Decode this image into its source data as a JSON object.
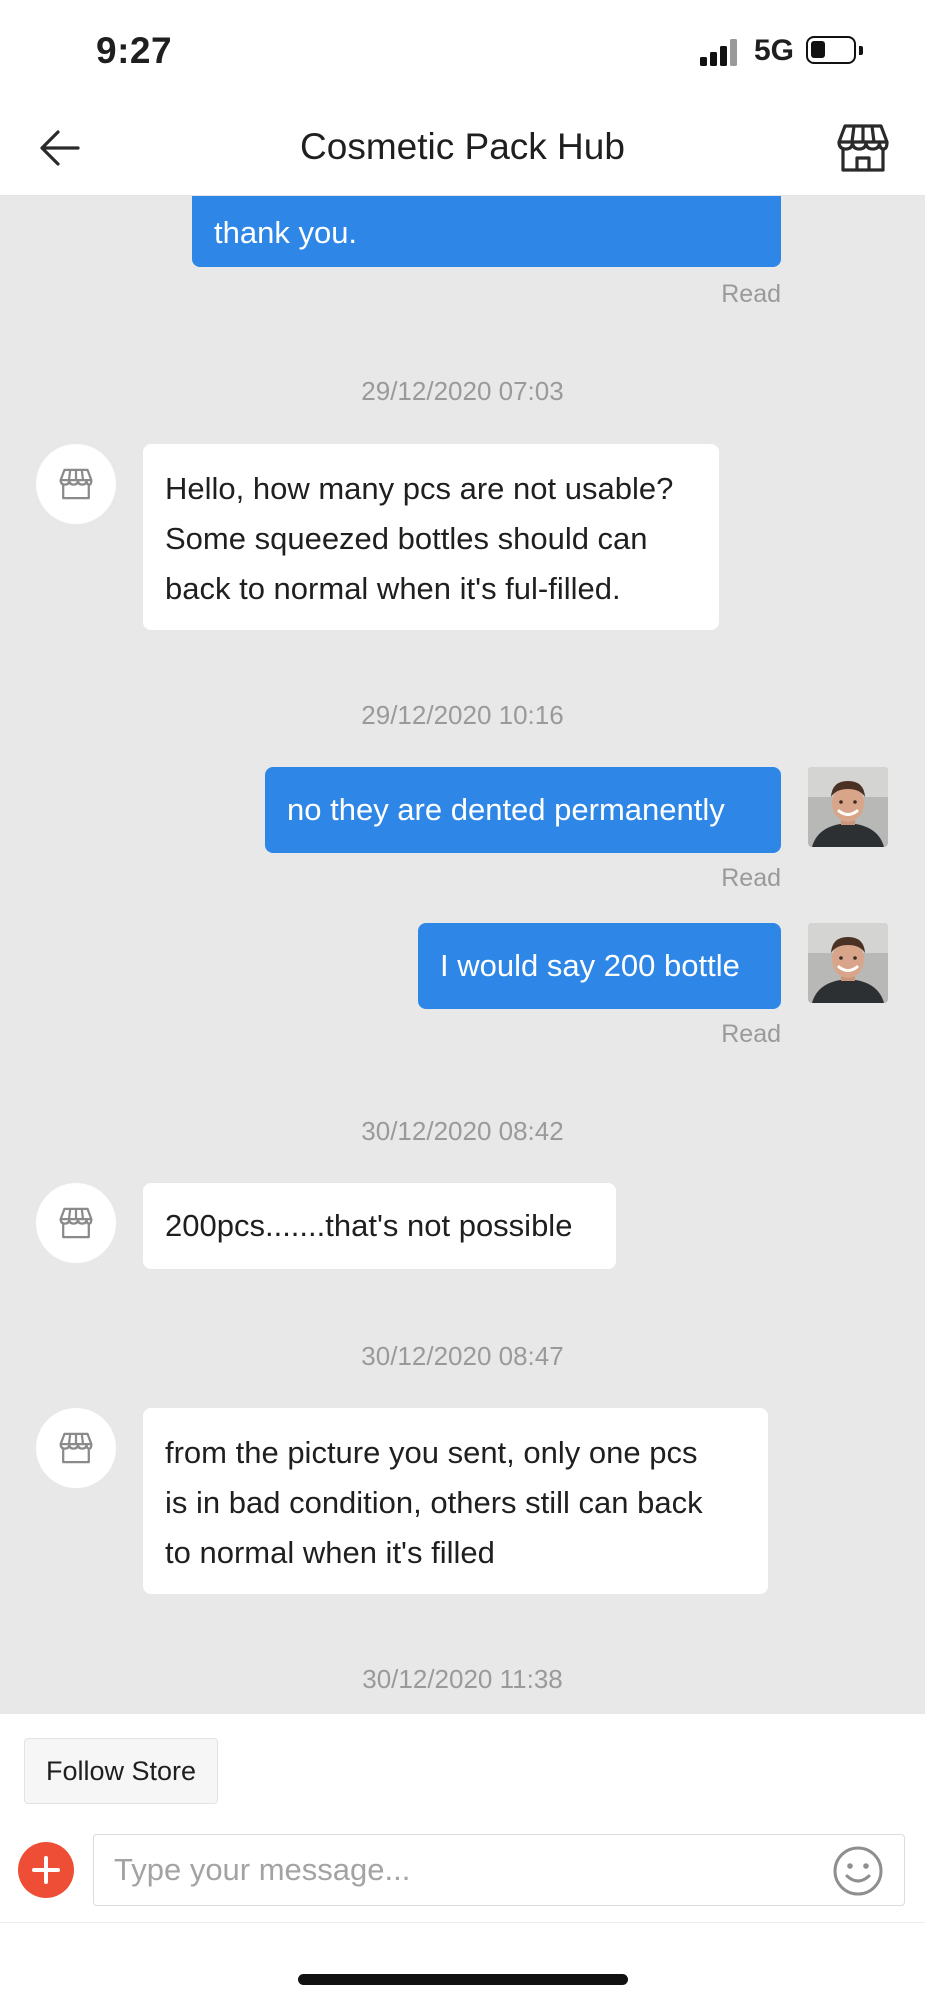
{
  "status_bar": {
    "time": "9:27",
    "network": "5G"
  },
  "header": {
    "title": "Cosmetic Pack Hub"
  },
  "messages": [
    {
      "text": "thank you.",
      "read": "Read"
    },
    {
      "timestamp": "29/12/2020 07:03",
      "lines": [
        "Hello, how many pcs are not usable?",
        "Some squeezed bottles should can",
        "back to normal when it's ful-filled."
      ]
    },
    {
      "timestamp": "29/12/2020 10:16",
      "text": "no they are dented permanently",
      "read": "Read"
    },
    {
      "text": "I would say 200 bottle",
      "read": "Read"
    },
    {
      "timestamp": "30/12/2020 08:42",
      "text": "200pcs.......that's not possible"
    },
    {
      "timestamp": "30/12/2020 08:47",
      "lines": [
        "from the picture you sent, only one pcs",
        "is in bad condition, others still can back",
        "to normal when it's filled"
      ]
    },
    {
      "timestamp": "30/12/2020 11:38"
    }
  ],
  "footer": {
    "follow_label": "Follow Store",
    "input_placeholder": "Type your message..."
  },
  "colors": {
    "accent": "#2e86e6",
    "add_button": "#ee4e35",
    "chat_bg": "#e8e8e8"
  },
  "icons": {
    "back": "arrow-left-icon",
    "store": "storefront-icon",
    "add": "plus-icon",
    "emoji": "smiley-icon"
  }
}
